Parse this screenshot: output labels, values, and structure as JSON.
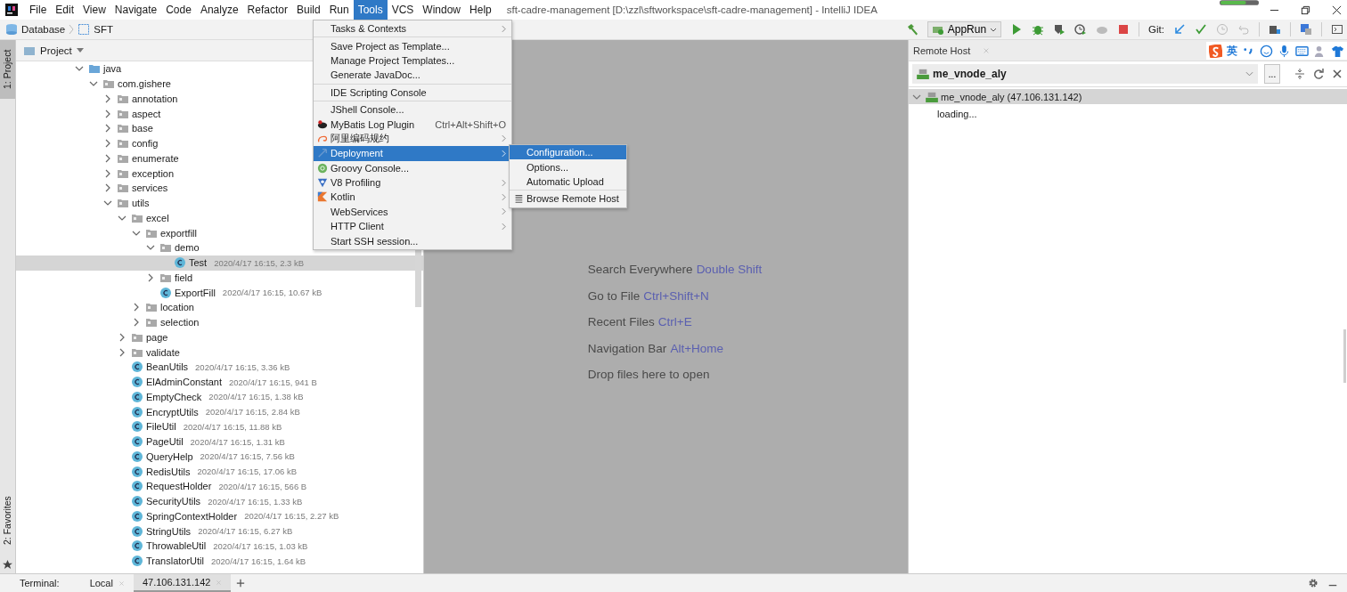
{
  "window": {
    "title": "sft-cadre-management [D:\\zzl\\sftworkspace\\sft-cadre-management] - IntelliJ IDEA"
  },
  "menu_bar": {
    "items": [
      {
        "label": "File",
        "selected": false
      },
      {
        "label": "Edit",
        "selected": false
      },
      {
        "label": "View",
        "selected": false
      },
      {
        "label": "Navigate",
        "selected": false
      },
      {
        "label": "Code",
        "selected": false
      },
      {
        "label": "Analyze",
        "selected": false
      },
      {
        "label": "Refactor",
        "selected": false
      },
      {
        "label": "Build",
        "selected": false
      },
      {
        "label": "Run",
        "selected": false
      },
      {
        "label": "Tools",
        "selected": true
      },
      {
        "label": "VCS",
        "selected": false
      },
      {
        "label": "Window",
        "selected": false
      },
      {
        "label": "Help",
        "selected": false
      }
    ]
  },
  "navigation": {
    "crumbs": [
      "Database",
      "SFT"
    ]
  },
  "toolbar": {
    "run_config": "AppRun",
    "vcs_label": "Git:"
  },
  "ime_bar": {
    "mode": "英"
  },
  "tools_menu": {
    "items": [
      {
        "label": "Tasks & Contexts",
        "submenu": true,
        "divider_above": false,
        "selected": false
      },
      {
        "label": "Save Project as Template...",
        "submenu": false,
        "divider_above": true,
        "selected": false
      },
      {
        "label": "Manage Project Templates...",
        "submenu": false,
        "divider_above": false,
        "selected": false
      },
      {
        "label": "Generate JavaDoc...",
        "submenu": false,
        "divider_above": false,
        "selected": false
      },
      {
        "label": "IDE Scripting Console",
        "submenu": false,
        "divider_above": true,
        "selected": false
      },
      {
        "label": "JShell Console...",
        "submenu": false,
        "divider_above": true,
        "selected": false
      },
      {
        "label": "MyBatis Log Plugin",
        "kind": "bird",
        "shortcut": "Ctrl+Alt+Shift+O",
        "submenu": false,
        "divider_above": false,
        "selected": false
      },
      {
        "label": "阿里编码规约",
        "kind": "swirl",
        "submenu": true,
        "divider_above": false,
        "selected": false
      },
      {
        "label": "Deployment",
        "kind": "deploy",
        "submenu": true,
        "divider_above": false,
        "selected": true
      },
      {
        "label": "Groovy Console...",
        "kind": "groovy",
        "submenu": false,
        "divider_above": false,
        "selected": false
      },
      {
        "label": "V8 Profiling",
        "kind": "v8",
        "submenu": true,
        "divider_above": false,
        "selected": false
      },
      {
        "label": "Kotlin",
        "kind": "kotlin",
        "submenu": true,
        "divider_above": false,
        "selected": false
      },
      {
        "label": "WebServices",
        "submenu": true,
        "divider_above": false,
        "selected": false
      },
      {
        "label": "HTTP Client",
        "submenu": true,
        "divider_above": false,
        "selected": false
      },
      {
        "label": "Start SSH session...",
        "submenu": false,
        "divider_above": false,
        "selected": false
      }
    ]
  },
  "deployment_submenu": {
    "items": [
      {
        "label": "Configuration...",
        "divider_above": false,
        "selected": true
      },
      {
        "label": "Options...",
        "divider_above": false,
        "selected": false
      },
      {
        "label": "Automatic Upload",
        "divider_above": false,
        "selected": false
      },
      {
        "label": "Browse Remote Host",
        "kind": "list",
        "divider_above": true,
        "selected": false
      }
    ]
  },
  "left_stripe": {
    "tabs": [
      {
        "label": "1: Project",
        "selected": true
      },
      {
        "label": "2: Favorites",
        "selected": false
      }
    ]
  },
  "project_panel": {
    "title": "Project",
    "tree": [
      {
        "name": "java",
        "kind": "source-root",
        "expanded": true,
        "children": [
          {
            "name": "com.gishere",
            "kind": "package",
            "expanded": true,
            "children": [
              {
                "name": "annotation",
                "kind": "package",
                "expanded": false
              },
              {
                "name": "aspect",
                "kind": "package",
                "expanded": false
              },
              {
                "name": "base",
                "kind": "package",
                "expanded": false
              },
              {
                "name": "config",
                "kind": "package",
                "expanded": false
              },
              {
                "name": "enumerate",
                "kind": "package",
                "expanded": false
              },
              {
                "name": "exception",
                "kind": "package",
                "expanded": false
              },
              {
                "name": "services",
                "kind": "package",
                "expanded": false
              },
              {
                "name": "utils",
                "kind": "package",
                "expanded": true,
                "children": [
                  {
                    "name": "excel",
                    "kind": "package",
                    "expanded": true,
                    "children": [
                      {
                        "name": "exportfill",
                        "kind": "package",
                        "expanded": true,
                        "children": [
                          {
                            "name": "demo",
                            "kind": "package",
                            "expanded": true,
                            "children": [
                              {
                                "name": "Test",
                                "kind": "class",
                                "meta": "2020/4/17 16:15, 2.3 kB",
                                "selected": true
                              }
                            ]
                          },
                          {
                            "name": "field",
                            "kind": "package",
                            "expanded": false
                          },
                          {
                            "name": "ExportFill",
                            "kind": "class",
                            "meta": "2020/4/17 16:15, 10.67 kB",
                            "selected": false
                          }
                        ]
                      },
                      {
                        "name": "location",
                        "kind": "package",
                        "expanded": false
                      },
                      {
                        "name": "selection",
                        "kind": "package",
                        "expanded": false
                      }
                    ]
                  },
                  {
                    "name": "page",
                    "kind": "package",
                    "expanded": false
                  },
                  {
                    "name": "validate",
                    "kind": "package",
                    "expanded": false
                  },
                  {
                    "name": "BeanUtils",
                    "kind": "class",
                    "meta": "2020/4/17 16:15, 3.36 kB",
                    "selected": false
                  },
                  {
                    "name": "ElAdminConstant",
                    "kind": "class",
                    "meta": "2020/4/17 16:15, 941 B",
                    "selected": false
                  },
                  {
                    "name": "EmptyCheck",
                    "kind": "class",
                    "meta": "2020/4/17 16:15, 1.38 kB",
                    "selected": false
                  },
                  {
                    "name": "EncryptUtils",
                    "kind": "class",
                    "meta": "2020/4/17 16:15, 2.84 kB",
                    "selected": false
                  },
                  {
                    "name": "FileUtil",
                    "kind": "class",
                    "meta": "2020/4/17 16:15, 11.88 kB",
                    "selected": false
                  },
                  {
                    "name": "PageUtil",
                    "kind": "class",
                    "meta": "2020/4/17 16:15, 1.31 kB",
                    "selected": false
                  },
                  {
                    "name": "QueryHelp",
                    "kind": "class",
                    "meta": "2020/4/17 16:15, 7.56 kB",
                    "selected": false
                  },
                  {
                    "name": "RedisUtils",
                    "kind": "class",
                    "meta": "2020/4/17 16:15, 17.06 kB",
                    "selected": false
                  },
                  {
                    "name": "RequestHolder",
                    "kind": "class",
                    "meta": "2020/4/17 16:15, 566 B",
                    "selected": false
                  },
                  {
                    "name": "SecurityUtils",
                    "kind": "class",
                    "meta": "2020/4/17 16:15, 1.33 kB",
                    "selected": false
                  },
                  {
                    "name": "SpringContextHolder",
                    "kind": "class",
                    "meta": "2020/4/17 16:15, 2.27 kB",
                    "selected": false
                  },
                  {
                    "name": "StringUtils",
                    "kind": "class",
                    "meta": "2020/4/17 16:15, 6.27 kB",
                    "selected": false
                  },
                  {
                    "name": "ThrowableUtil",
                    "kind": "class",
                    "meta": "2020/4/17 16:15, 1.03 kB",
                    "selected": false
                  },
                  {
                    "name": "TranslatorUtil",
                    "kind": "class",
                    "meta": "2020/4/17 16:15, 1.64 kB",
                    "selected": false
                  }
                ]
              }
            ]
          }
        ]
      }
    ]
  },
  "editor": {
    "hints": [
      {
        "text": "Search Everywhere",
        "shortcut": "Double Shift"
      },
      {
        "text": "Go to File",
        "shortcut": "Ctrl+Shift+N"
      },
      {
        "text": "Recent Files",
        "shortcut": "Ctrl+E"
      },
      {
        "text": "Navigation Bar",
        "shortcut": "Alt+Home"
      },
      {
        "text": "Drop files here to open"
      }
    ]
  },
  "remote_host": {
    "title": "Remote Host",
    "server": "me_vnode_aly",
    "more": "...",
    "tree": [
      {
        "label": "me_vnode_aly (47.106.131.142)",
        "expanded": true,
        "selected": true,
        "children": [
          {
            "label": "loading..."
          }
        ]
      }
    ]
  },
  "terminal": {
    "label": "Terminal:",
    "tabs": [
      {
        "label": "Local",
        "selected": false
      },
      {
        "label": "47.106.131.142",
        "selected": true
      }
    ]
  }
}
